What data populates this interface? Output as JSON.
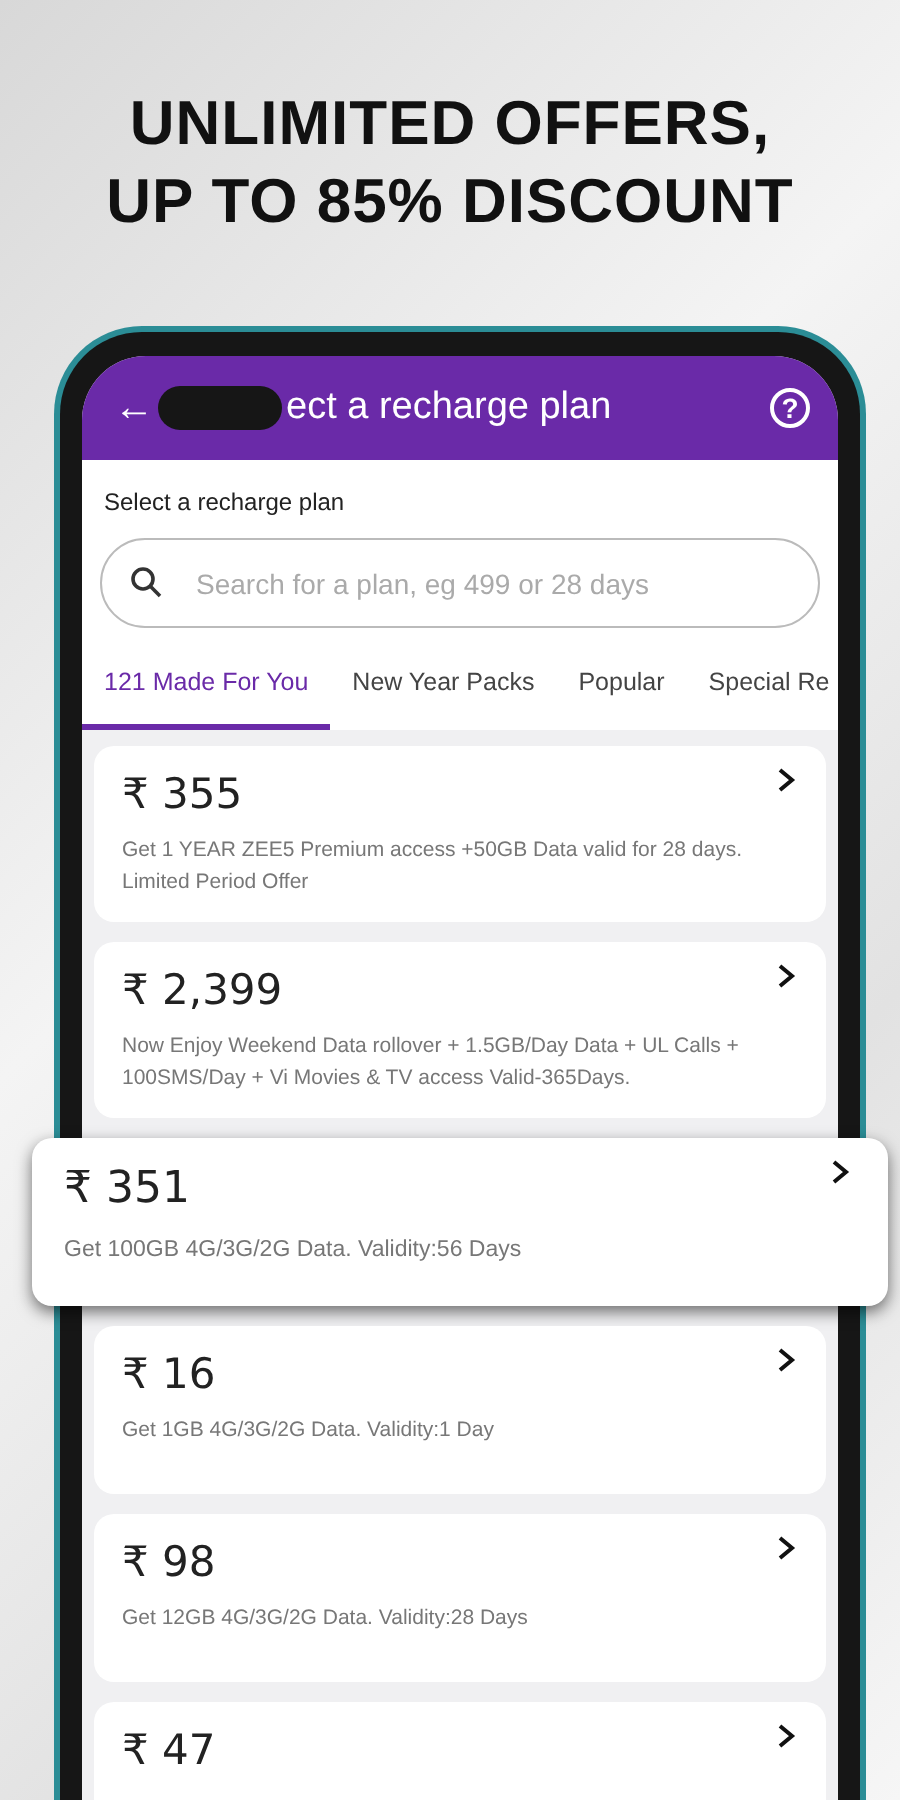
{
  "headline": [
    "UNLIMITED OFFERS,",
    "UP TO 85% DISCOUNT"
  ],
  "header": {
    "back": "←",
    "title": "ect a recharge plan",
    "help": "?"
  },
  "section_label": "Select a recharge plan",
  "search": {
    "placeholder": "Search for a plan, eg 499 or 28 days"
  },
  "tabs": [
    {
      "label": "121 Made For You",
      "selected": true
    },
    {
      "label": "New Year Packs",
      "selected": false
    },
    {
      "label": "Popular",
      "selected": false
    },
    {
      "label": "Special Re",
      "selected": false
    }
  ],
  "plans": [
    {
      "price": "₹ 355",
      "description": "Get 1 YEAR ZEE5 Premium access +50GB Data valid for 28 days. Limited Period Offer",
      "highlighted": false
    },
    {
      "price": "₹ 2,399",
      "description": "Now Enjoy Weekend Data rollover + 1.5GB/Day Data + UL Calls + 100SMS/Day + Vi Movies & TV access Valid-365Days.",
      "highlighted": false
    },
    {
      "price": "₹ 351",
      "description": "Get 100GB 4G/3G/2G Data. Validity:56 Days",
      "highlighted": true
    },
    {
      "price": "₹ 16",
      "description": "Get 1GB 4G/3G/2G Data. Validity:1 Day",
      "highlighted": false
    },
    {
      "price": "₹ 98",
      "description": "Get 12GB 4G/3G/2G Data. Validity:28 Days",
      "highlighted": false
    },
    {
      "price": "₹ 47",
      "highlighted": false
    }
  ]
}
